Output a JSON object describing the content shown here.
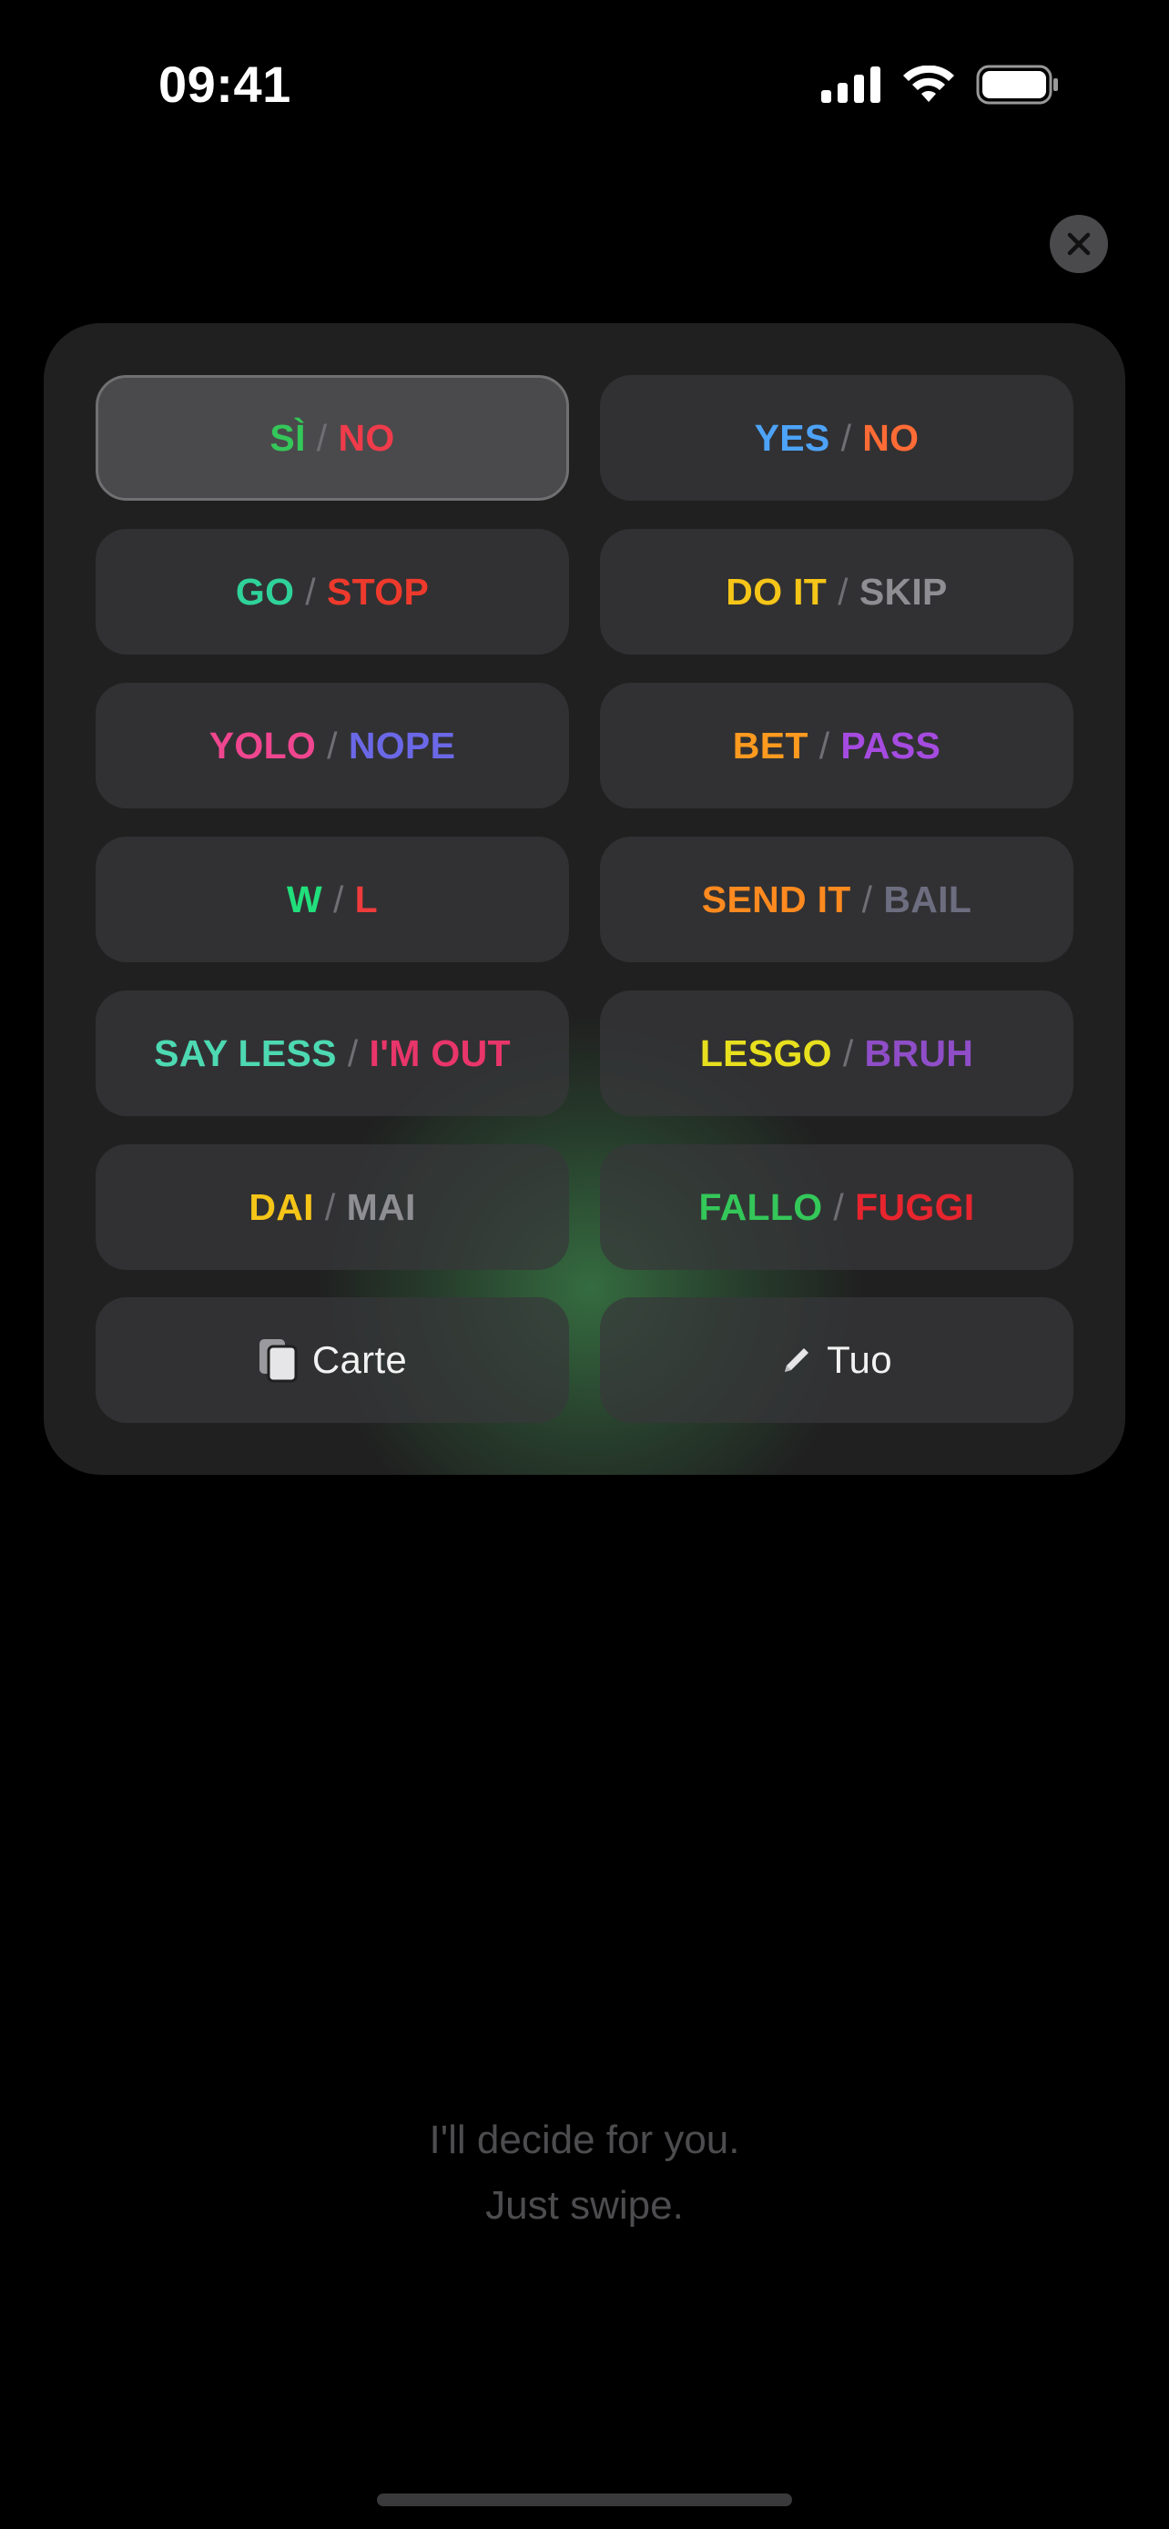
{
  "status_bar": {
    "time": "09:41"
  },
  "options": [
    {
      "left": "SÌ",
      "right": "NO",
      "left_color": "#34c759",
      "right_color": "#ef3b4a",
      "selected": true
    },
    {
      "left": "YES",
      "right": "NO",
      "left_color": "#4da3f7",
      "right_color": "#ff6b35",
      "selected": false
    },
    {
      "left": "GO",
      "right": "STOP",
      "left_color": "#2fd39a",
      "right_color": "#ee3a2c",
      "selected": false
    },
    {
      "left": "DO IT",
      "right": "SKIP",
      "left_color": "#f5c518",
      "right_color": "#8e8e93",
      "selected": false
    },
    {
      "left": "YOLO",
      "right": "NOPE",
      "left_color": "#f0468f",
      "right_color": "#6b68e8",
      "selected": false
    },
    {
      "left": "BET",
      "right": "PASS",
      "left_color": "#ff9a1f",
      "right_color": "#a54be0",
      "selected": false
    },
    {
      "left": "W",
      "right": "L",
      "left_color": "#21e07c",
      "right_color": "#ef3b3b",
      "selected": false
    },
    {
      "left": "SEND IT",
      "right": "BAIL",
      "left_color": "#ff8a1f",
      "right_color": "#6d6d80",
      "selected": false
    },
    {
      "left": "SAY LESS",
      "right": "I'M OUT",
      "left_color": "#4dd9b2",
      "right_color": "#e8356a",
      "selected": false
    },
    {
      "left": "LESGO",
      "right": "BRUH",
      "left_color": "#e8e01e",
      "right_color": "#8f4ec8",
      "selected": false
    },
    {
      "left": "DAI",
      "right": "MAI",
      "left_color": "#f5c518",
      "right_color": "#8e8e93",
      "selected": false
    },
    {
      "left": "FALLO",
      "right": "FUGGI",
      "left_color": "#34c759",
      "right_color": "#e8252e",
      "selected": false
    }
  ],
  "separator": "/",
  "actions": {
    "cards_label": "Carte",
    "cards_icon": "cards-icon",
    "custom_label": "Tuo",
    "custom_icon": "pencil-icon"
  },
  "tagline": {
    "line1": "I'll decide for you.",
    "line2": "Just swipe."
  },
  "colors": {
    "background": "#000000",
    "panel": "#202020",
    "glow": "#46aa5a"
  }
}
